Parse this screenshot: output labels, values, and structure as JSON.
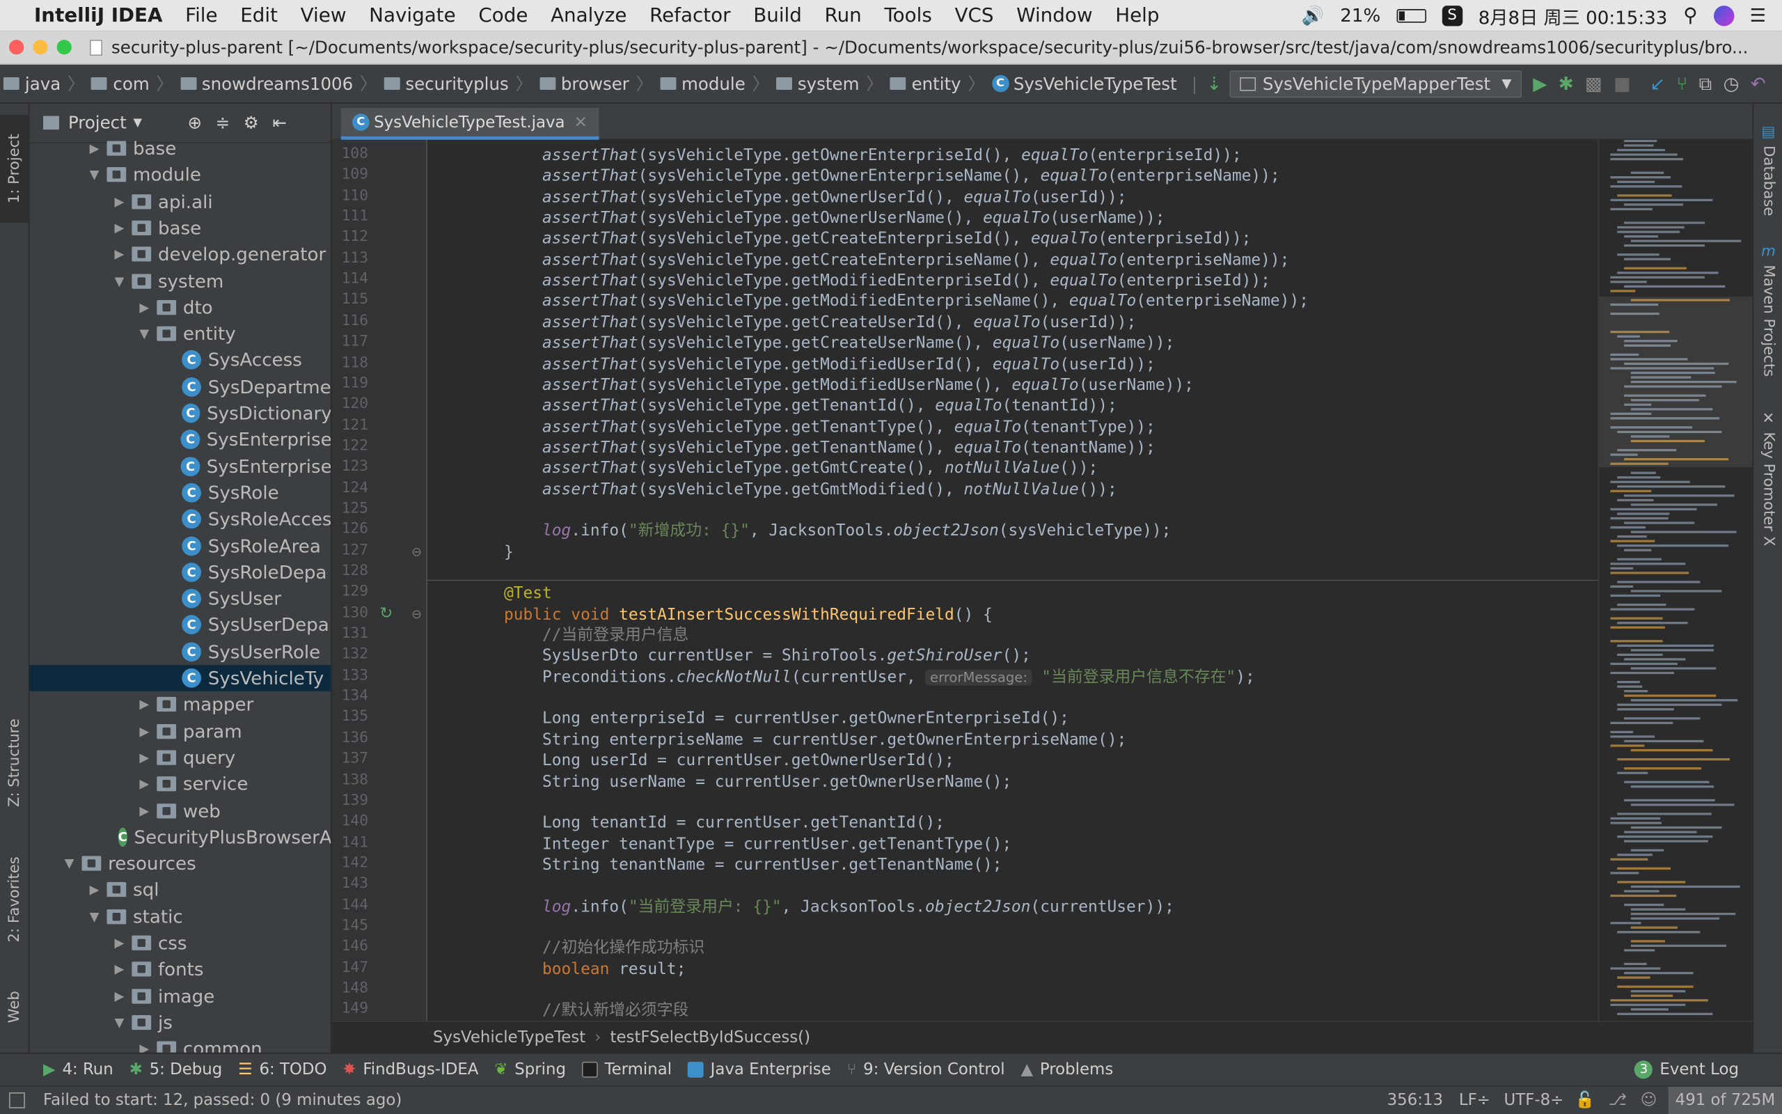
{
  "menubar": {
    "apple": "",
    "app_name": "IntelliJ IDEA",
    "items": [
      "File",
      "Edit",
      "View",
      "Navigate",
      "Code",
      "Analyze",
      "Refactor",
      "Build",
      "Run",
      "Tools",
      "VCS",
      "Window",
      "Help"
    ],
    "battery": "21%",
    "datetime": "8月8日 周三  00:15:33"
  },
  "window": {
    "title": "security-plus-parent [~/Documents/workspace/security-plus/security-plus-parent] - ~/Documents/workspace/security-plus/zui56-browser/src/test/java/com/snowdreams1006/securityplus/bro..."
  },
  "navbar": {
    "crumbs": [
      "java",
      "com",
      "snowdreams1006",
      "securityplus",
      "browser",
      "module",
      "system",
      "entity"
    ],
    "class_crumb": "SysVehicleTypeTest",
    "run_config": "SysVehicleTypeMapperTest"
  },
  "left_strip": {
    "project": "1: Project",
    "structure": "Z: Structure",
    "favorites": "2: Favorites",
    "web": "Web"
  },
  "right_strip": {
    "database": "Database",
    "maven": "Maven Projects",
    "keypromoter": "Key Promoter X"
  },
  "project_panel": {
    "title": "Project",
    "tree": [
      {
        "label": "base",
        "indent": 2,
        "type": "folder",
        "arrow": "▶"
      },
      {
        "label": "module",
        "indent": 2,
        "type": "folder",
        "arrow": "▼"
      },
      {
        "label": "api.ali",
        "indent": 3,
        "type": "folder",
        "arrow": "▶"
      },
      {
        "label": "base",
        "indent": 3,
        "type": "folder",
        "arrow": "▶"
      },
      {
        "label": "develop.generator",
        "indent": 3,
        "type": "folder",
        "arrow": "▶"
      },
      {
        "label": "system",
        "indent": 3,
        "type": "folder",
        "arrow": "▼"
      },
      {
        "label": "dto",
        "indent": 4,
        "type": "folder",
        "arrow": "▶"
      },
      {
        "label": "entity",
        "indent": 4,
        "type": "folder",
        "arrow": "▼"
      },
      {
        "label": "SysAccess",
        "indent": 5,
        "type": "class",
        "arrow": ""
      },
      {
        "label": "SysDepartme",
        "indent": 5,
        "type": "class",
        "arrow": ""
      },
      {
        "label": "SysDictionary",
        "indent": 5,
        "type": "class",
        "arrow": ""
      },
      {
        "label": "SysEnterprise",
        "indent": 5,
        "type": "class",
        "arrow": ""
      },
      {
        "label": "SysEnterprise",
        "indent": 5,
        "type": "class",
        "arrow": ""
      },
      {
        "label": "SysRole",
        "indent": 5,
        "type": "class",
        "arrow": ""
      },
      {
        "label": "SysRoleAcces",
        "indent": 5,
        "type": "class",
        "arrow": ""
      },
      {
        "label": "SysRoleArea",
        "indent": 5,
        "type": "class",
        "arrow": ""
      },
      {
        "label": "SysRoleDepa",
        "indent": 5,
        "type": "class",
        "arrow": ""
      },
      {
        "label": "SysUser",
        "indent": 5,
        "type": "class",
        "arrow": ""
      },
      {
        "label": "SysUserDepa",
        "indent": 5,
        "type": "class",
        "arrow": ""
      },
      {
        "label": "SysUserRole",
        "indent": 5,
        "type": "class",
        "arrow": ""
      },
      {
        "label": "SysVehicleTy",
        "indent": 5,
        "type": "class",
        "arrow": "",
        "selected": true
      },
      {
        "label": "mapper",
        "indent": 4,
        "type": "folder",
        "arrow": "▶"
      },
      {
        "label": "param",
        "indent": 4,
        "type": "folder",
        "arrow": "▶"
      },
      {
        "label": "query",
        "indent": 4,
        "type": "folder",
        "arrow": "▶"
      },
      {
        "label": "service",
        "indent": 4,
        "type": "folder",
        "arrow": "▶"
      },
      {
        "label": "web",
        "indent": 4,
        "type": "folder",
        "arrow": "▶"
      },
      {
        "label": "SecurityPlusBrowserA",
        "indent": 3,
        "type": "springclass",
        "arrow": ""
      },
      {
        "label": "resources",
        "indent": 1,
        "type": "folder",
        "arrow": "▼"
      },
      {
        "label": "sql",
        "indent": 2,
        "type": "folder",
        "arrow": "▶"
      },
      {
        "label": "static",
        "indent": 2,
        "type": "folder",
        "arrow": "▼"
      },
      {
        "label": "css",
        "indent": 3,
        "type": "folder",
        "arrow": "▶"
      },
      {
        "label": "fonts",
        "indent": 3,
        "type": "folder",
        "arrow": "▶"
      },
      {
        "label": "image",
        "indent": 3,
        "type": "folder",
        "arrow": "▶"
      },
      {
        "label": "js",
        "indent": 3,
        "type": "folder",
        "arrow": "▼"
      },
      {
        "label": "common",
        "indent": 4,
        "type": "folder",
        "arrow": "▶"
      }
    ]
  },
  "editor": {
    "tab_label": "SysVehicleTypeTest.java",
    "first_line": 108,
    "lines": [
      [
        {
          "t": "            "
        },
        {
          "t": "assertThat",
          "c": "it"
        },
        {
          "t": "(sysVehicleType.getOwnerEnterpriseId(), "
        },
        {
          "t": "equalTo",
          "c": "it"
        },
        {
          "t": "(enterpriseId));"
        }
      ],
      [
        {
          "t": "            "
        },
        {
          "t": "assertThat",
          "c": "it"
        },
        {
          "t": "(sysVehicleType.getOwnerEnterpriseName(), "
        },
        {
          "t": "equalTo",
          "c": "it"
        },
        {
          "t": "(enterpriseName));"
        }
      ],
      [
        {
          "t": "            "
        },
        {
          "t": "assertThat",
          "c": "it"
        },
        {
          "t": "(sysVehicleType.getOwnerUserId(), "
        },
        {
          "t": "equalTo",
          "c": "it"
        },
        {
          "t": "(userId));"
        }
      ],
      [
        {
          "t": "            "
        },
        {
          "t": "assertThat",
          "c": "it"
        },
        {
          "t": "(sysVehicleType.getOwnerUserName(), "
        },
        {
          "t": "equalTo",
          "c": "it"
        },
        {
          "t": "(userName));"
        }
      ],
      [
        {
          "t": "            "
        },
        {
          "t": "assertThat",
          "c": "it"
        },
        {
          "t": "(sysVehicleType.getCreateEnterpriseId(), "
        },
        {
          "t": "equalTo",
          "c": "it"
        },
        {
          "t": "(enterpriseId));"
        }
      ],
      [
        {
          "t": "            "
        },
        {
          "t": "assertThat",
          "c": "it"
        },
        {
          "t": "(sysVehicleType.getCreateEnterpriseName(), "
        },
        {
          "t": "equalTo",
          "c": "it"
        },
        {
          "t": "(enterpriseName));"
        }
      ],
      [
        {
          "t": "            "
        },
        {
          "t": "assertThat",
          "c": "it"
        },
        {
          "t": "(sysVehicleType.getModifiedEnterpriseId(), "
        },
        {
          "t": "equalTo",
          "c": "it"
        },
        {
          "t": "(enterpriseId));"
        }
      ],
      [
        {
          "t": "            "
        },
        {
          "t": "assertThat",
          "c": "it"
        },
        {
          "t": "(sysVehicleType.getModifiedEnterpriseName(), "
        },
        {
          "t": "equalTo",
          "c": "it"
        },
        {
          "t": "(enterpriseName));"
        }
      ],
      [
        {
          "t": "            "
        },
        {
          "t": "assertThat",
          "c": "it"
        },
        {
          "t": "(sysVehicleType.getCreateUserId(), "
        },
        {
          "t": "equalTo",
          "c": "it"
        },
        {
          "t": "(userId));"
        }
      ],
      [
        {
          "t": "            "
        },
        {
          "t": "assertThat",
          "c": "it"
        },
        {
          "t": "(sysVehicleType.getCreateUserName(), "
        },
        {
          "t": "equalTo",
          "c": "it"
        },
        {
          "t": "(userName));"
        }
      ],
      [
        {
          "t": "            "
        },
        {
          "t": "assertThat",
          "c": "it"
        },
        {
          "t": "(sysVehicleType.getModifiedUserId(), "
        },
        {
          "t": "equalTo",
          "c": "it"
        },
        {
          "t": "(userId));"
        }
      ],
      [
        {
          "t": "            "
        },
        {
          "t": "assertThat",
          "c": "it"
        },
        {
          "t": "(sysVehicleType.getModifiedUserName(), "
        },
        {
          "t": "equalTo",
          "c": "it"
        },
        {
          "t": "(userName));"
        }
      ],
      [
        {
          "t": "            "
        },
        {
          "t": "assertThat",
          "c": "it"
        },
        {
          "t": "(sysVehicleType.getTenantId(), "
        },
        {
          "t": "equalTo",
          "c": "it"
        },
        {
          "t": "(tenantId));"
        }
      ],
      [
        {
          "t": "            "
        },
        {
          "t": "assertThat",
          "c": "it"
        },
        {
          "t": "(sysVehicleType.getTenantType(), "
        },
        {
          "t": "equalTo",
          "c": "it"
        },
        {
          "t": "(tenantType));"
        }
      ],
      [
        {
          "t": "            "
        },
        {
          "t": "assertThat",
          "c": "it"
        },
        {
          "t": "(sysVehicleType.getTenantName(), "
        },
        {
          "t": "equalTo",
          "c": "it"
        },
        {
          "t": "(tenantName));"
        }
      ],
      [
        {
          "t": "            "
        },
        {
          "t": "assertThat",
          "c": "it"
        },
        {
          "t": "(sysVehicleType.getGmtCreate(), "
        },
        {
          "t": "notNullValue",
          "c": "it"
        },
        {
          "t": "());"
        }
      ],
      [
        {
          "t": "            "
        },
        {
          "t": "assertThat",
          "c": "it"
        },
        {
          "t": "(sysVehicleType.getGmtModified(), "
        },
        {
          "t": "notNullValue",
          "c": "it"
        },
        {
          "t": "());"
        }
      ],
      [],
      [
        {
          "t": "            "
        },
        {
          "t": "log",
          "c": "purp it"
        },
        {
          "t": ".info("
        },
        {
          "t": "\"新增成功: {}\"",
          "c": "str"
        },
        {
          "t": ", JacksonTools."
        },
        {
          "t": "object2Json",
          "c": "it"
        },
        {
          "t": "(sysVehicleType));"
        }
      ],
      [
        {
          "t": "        }"
        }
      ],
      [],
      [
        {
          "t": "        "
        },
        {
          "t": "@Test",
          "c": "ann"
        }
      ],
      [
        {
          "t": "        "
        },
        {
          "t": "public void ",
          "c": "kw"
        },
        {
          "t": "testAInsertSuccessWithRequiredField",
          "c": "fn"
        },
        {
          "t": "() {"
        }
      ],
      [
        {
          "t": "            "
        },
        {
          "t": "//当前登录用户信息",
          "c": "cm"
        }
      ],
      [
        {
          "t": "            SysUserDto currentUser = ShiroTools."
        },
        {
          "t": "getShiroUser",
          "c": "it"
        },
        {
          "t": "();"
        }
      ],
      [
        {
          "t": "            Preconditions."
        },
        {
          "t": "checkNotNull",
          "c": "it"
        },
        {
          "t": "(currentUser, "
        },
        {
          "t": "errorMessage:",
          "c": "hint"
        },
        {
          "t": " "
        },
        {
          "t": "\"当前登录用户信息不存在\"",
          "c": "str"
        },
        {
          "t": ");"
        }
      ],
      [],
      [
        {
          "t": "            Long enterpriseId = currentUser.getOwnerEnterpriseId();"
        }
      ],
      [
        {
          "t": "            String enterpriseName = currentUser.getOwnerEnterpriseName();"
        }
      ],
      [
        {
          "t": "            Long userId = currentUser.getOwnerUserId();"
        }
      ],
      [
        {
          "t": "            String userName = currentUser.getOwnerUserName();"
        }
      ],
      [],
      [
        {
          "t": "            Long tenantId = currentUser.getTenantId();"
        }
      ],
      [
        {
          "t": "            Integer tenantType = currentUser.getTenantType();"
        }
      ],
      [
        {
          "t": "            String tenantName = currentUser.getTenantName();"
        }
      ],
      [],
      [
        {
          "t": "            "
        },
        {
          "t": "log",
          "c": "purp it"
        },
        {
          "t": ".info("
        },
        {
          "t": "\"当前登录用户: {}\"",
          "c": "str"
        },
        {
          "t": ", JacksonTools."
        },
        {
          "t": "object2Json",
          "c": "it"
        },
        {
          "t": "(currentUser));"
        }
      ],
      [],
      [
        {
          "t": "            "
        },
        {
          "t": "//初始化操作成功标识",
          "c": "cm"
        }
      ],
      [
        {
          "t": "            "
        },
        {
          "t": "boolean ",
          "c": "kw"
        },
        {
          "t": "result;"
        }
      ],
      [],
      [
        {
          "t": "            "
        },
        {
          "t": "//默认新增必须字段",
          "c": "cm"
        }
      ]
    ]
  },
  "breadcrumb": {
    "class": "SysVehicleTypeTest",
    "method": "testFSelectByIdSuccess()"
  },
  "tool_tabs": {
    "run": "4: Run",
    "debug": "5: Debug",
    "todo": "6: TODO",
    "findbugs": "FindBugs-IDEA",
    "spring": "Spring",
    "terminal": "Terminal",
    "javaee": "Java Enterprise",
    "vcs": "9: Version Control",
    "problems": "Problems",
    "eventlog": "Event Log",
    "eventlog_count": "3"
  },
  "status": {
    "message": "Failed to start: 12, passed: 0 (9 minutes ago)",
    "position": "356:13",
    "line_sep": "LF÷",
    "encoding": "UTF-8÷",
    "memory": "491 of 725M"
  },
  "colors": {
    "selection": "#0d293e",
    "accent_tab": "#4a88c7",
    "run_green": "#59a869"
  }
}
